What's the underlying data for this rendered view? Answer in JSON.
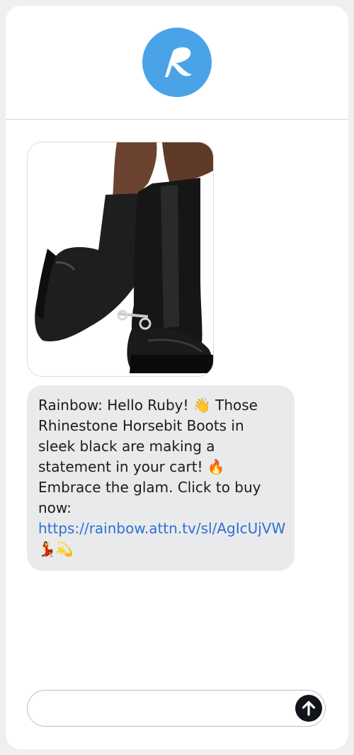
{
  "header": {
    "avatar_icon": "rainbow-r-logo"
  },
  "product": {
    "image_icon": "black-knee-high-boots-photo"
  },
  "message": {
    "text_before_link": "Rainbow: Hello Ruby! 👋 Those Rhinestone Horsebit Boots in sleek black are making a statement in your cart! 🔥 Embrace the glam. Click to buy now: ",
    "link_text": "https://rainbow.attn.tv/sl/AgIcUjVW",
    "text_after_link": " 💃💫"
  },
  "composer": {
    "placeholder": "",
    "send_icon": "arrow-up-icon"
  },
  "colors": {
    "brand": "#4aa3e6",
    "bubble": "#e9eaeb",
    "link": "#2f6fd6",
    "send_button": "#111418"
  }
}
